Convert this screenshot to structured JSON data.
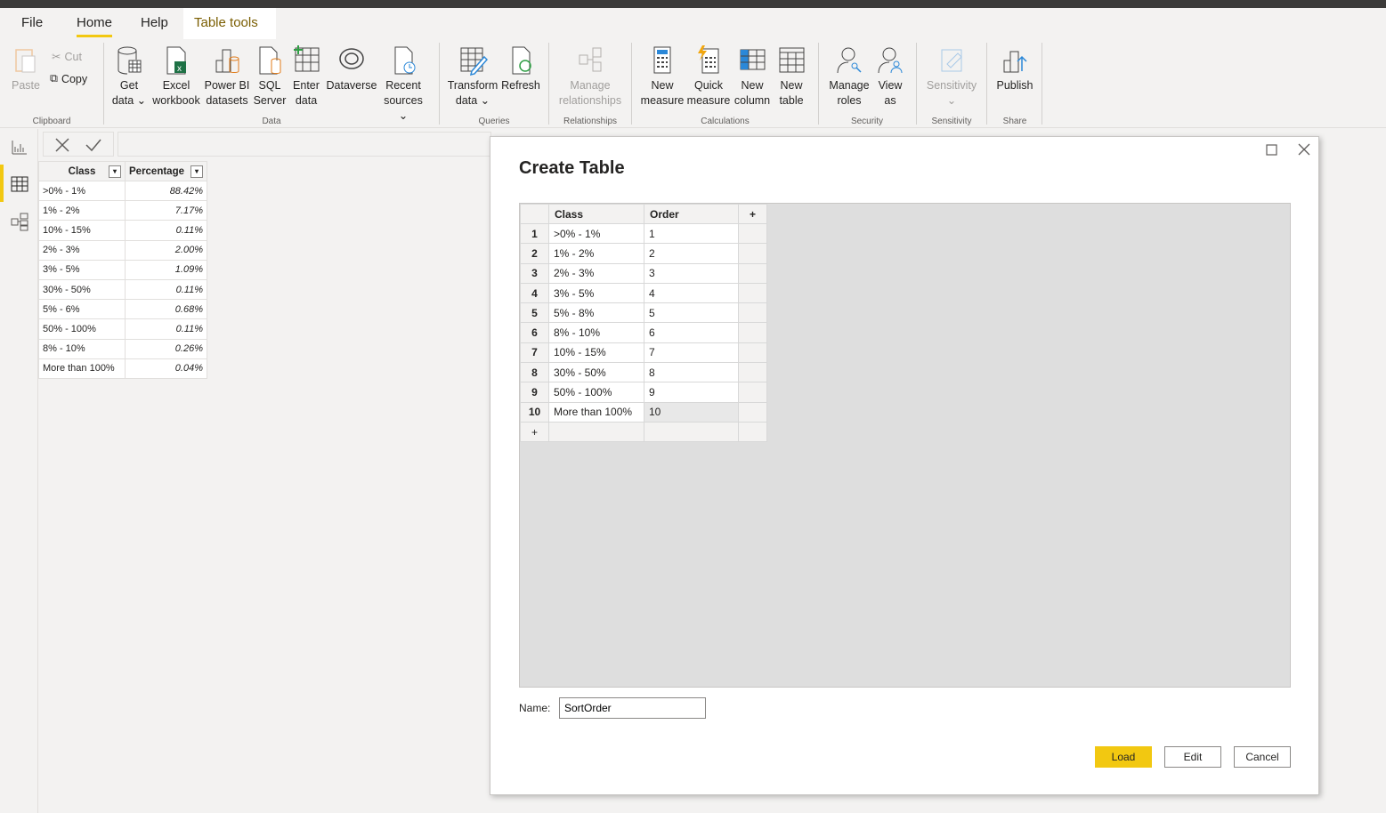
{
  "menu_tabs": [
    {
      "label": "File"
    },
    {
      "label": "Home",
      "active": true
    },
    {
      "label": "Help"
    },
    {
      "label": "Table tools",
      "contextual": true
    }
  ],
  "ribbon": {
    "clipboard": {
      "group_label": "Clipboard",
      "paste": "Paste",
      "cut": "Cut",
      "copy": "Copy"
    },
    "data": {
      "group_label": "Data",
      "get_data": [
        "Get",
        "data"
      ],
      "excel": [
        "Excel",
        "workbook"
      ],
      "powerbi": [
        "Power BI",
        "datasets"
      ],
      "sql": [
        "SQL",
        "Server"
      ],
      "enter": [
        "Enter",
        "data"
      ],
      "dataverse": [
        "Dataverse",
        ""
      ],
      "recent": [
        "Recent",
        "sources"
      ]
    },
    "queries": {
      "group_label": "Queries",
      "transform": [
        "Transform",
        "data"
      ],
      "refresh": [
        "Refresh",
        ""
      ]
    },
    "relationships": {
      "group_label": "Relationships",
      "manage": [
        "Manage",
        "relationships"
      ]
    },
    "calculations": {
      "group_label": "Calculations",
      "new_measure": [
        "New",
        "measure"
      ],
      "quick_measure": [
        "Quick",
        "measure"
      ],
      "new_column": [
        "New",
        "column"
      ],
      "new_table": [
        "New",
        "table"
      ]
    },
    "security": {
      "group_label": "Security",
      "manage_roles": [
        "Manage",
        "roles"
      ],
      "view_as": [
        "View",
        "as"
      ]
    },
    "sensitivity": {
      "group_label": "Sensitivity",
      "sensitivity": [
        "Sensitivity",
        ""
      ]
    },
    "share": {
      "group_label": "Share",
      "publish": [
        "Publish",
        ""
      ]
    }
  },
  "data_table": {
    "columns": [
      "Class",
      "Percentage"
    ],
    "rows": [
      [
        ">0% - 1%",
        "88.42%"
      ],
      [
        "1% - 2%",
        "7.17%"
      ],
      [
        "10% - 15%",
        "0.11%"
      ],
      [
        "2% - 3%",
        "2.00%"
      ],
      [
        "3% - 5%",
        "1.09%"
      ],
      [
        "30% - 50%",
        "0.11%"
      ],
      [
        "5% - 6%",
        "0.68%"
      ],
      [
        "50% - 100%",
        "0.11%"
      ],
      [
        "8% - 10%",
        "0.26%"
      ],
      [
        "More than 100%",
        "0.04%"
      ]
    ]
  },
  "dialog": {
    "title": "Create Table",
    "columns": [
      "Class",
      "Order"
    ],
    "add_column": "+",
    "add_row": "+",
    "rows": [
      [
        "1",
        ">0% - 1%",
        "1"
      ],
      [
        "2",
        "1% - 2%",
        "2"
      ],
      [
        "3",
        "2% - 3%",
        "3"
      ],
      [
        "4",
        "3% - 5%",
        "4"
      ],
      [
        "5",
        "5% - 8%",
        "5"
      ],
      [
        "6",
        "8% - 10%",
        "6"
      ],
      [
        "7",
        "10% - 15%",
        "7"
      ],
      [
        "8",
        "30% - 50%",
        "8"
      ],
      [
        "9",
        "50% - 100%",
        "9"
      ],
      [
        "10",
        "More than 100%",
        "10"
      ]
    ],
    "name_label": "Name:",
    "name_value": "SortOrder",
    "load": "Load",
    "edit": "Edit",
    "cancel": "Cancel"
  },
  "colors": {
    "accent": "#f2c811",
    "ribbon_bg": "#f3f2f1"
  }
}
